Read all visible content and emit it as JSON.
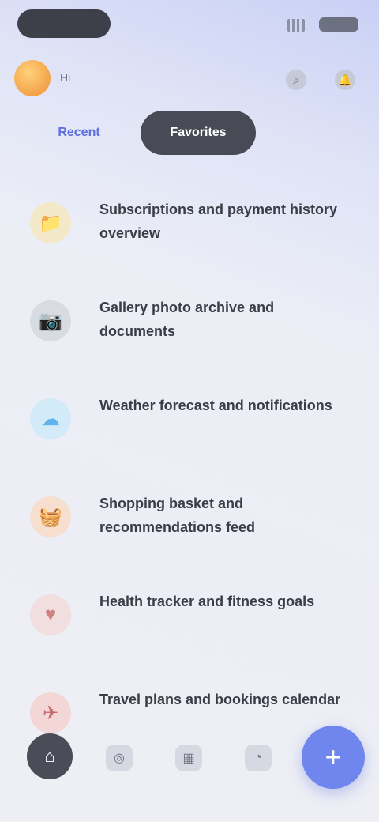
{
  "header": {
    "user_name": "Hi",
    "icons": [
      "search-icon",
      "bell-icon"
    ]
  },
  "tabs": [
    {
      "label": "Recent",
      "active": false
    },
    {
      "label": "Favorites",
      "active": true
    }
  ],
  "items": [
    {
      "title": "Subscriptions and payment history overview",
      "icon": "folder-icon",
      "icon_glyph": "📁",
      "icon_bg": "#f3e9c9"
    },
    {
      "title": "Gallery photo archive and documents",
      "icon": "camera-icon",
      "icon_glyph": "📷",
      "icon_bg": "#d9dbe2"
    },
    {
      "title": "Weather forecast and notifications",
      "icon": "cloud-icon",
      "icon_glyph": "☁",
      "icon_bg": "#d3eaf9"
    },
    {
      "title": "Shopping basket and recommendations feed",
      "icon": "basket-icon",
      "icon_glyph": "🧺",
      "icon_bg": "#f6dfcf"
    },
    {
      "title": "Health tracker and fitness goals",
      "icon": "heart-icon",
      "icon_glyph": "♥",
      "icon_bg": "#f1dede"
    },
    {
      "title": "Travel plans and bookings calendar",
      "icon": "plane-icon",
      "icon_glyph": "✈",
      "icon_bg": "#f3d6d6"
    }
  ],
  "tab_bar": {
    "items": [
      "home-icon",
      "compass-icon",
      "grid-icon",
      "profile-icon"
    ],
    "fab_icon": "plus-icon",
    "fab_glyph": "+"
  },
  "colors": {
    "accent": "#6e86ee",
    "active_tab": "#484b55",
    "inactive_tab_text": "#5c6ee0"
  }
}
